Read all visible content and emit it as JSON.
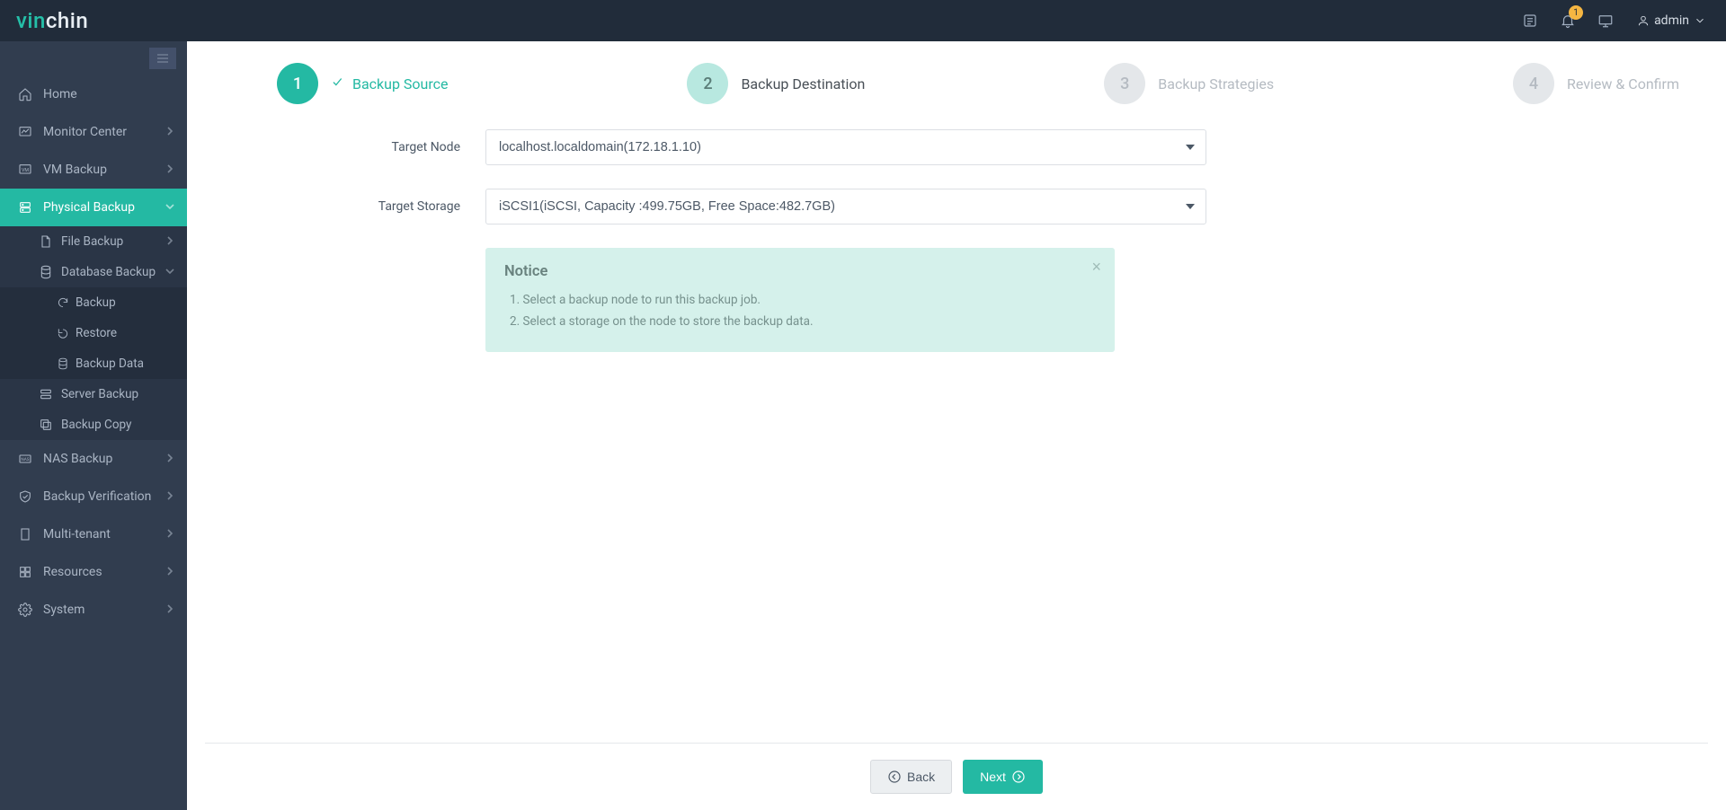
{
  "brand": {
    "part1": "vin",
    "part2": "chin"
  },
  "topbar": {
    "bell_badge": "1",
    "username": "admin"
  },
  "sidebar": {
    "home": "Home",
    "monitor": "Monitor Center",
    "vm": "VM Backup",
    "physical": "Physical Backup",
    "file": "File Backup",
    "database": "Database Backup",
    "db_backup": "Backup",
    "db_restore": "Restore",
    "db_data": "Backup Data",
    "server": "Server Backup",
    "copy": "Backup Copy",
    "nas": "NAS Backup",
    "verify": "Backup Verification",
    "tenant": "Multi-tenant",
    "resources": "Resources",
    "system": "System"
  },
  "wizard": {
    "step1_num": "1",
    "step1_label": "Backup Source",
    "step2_num": "2",
    "step2_label": "Backup Destination",
    "step3_num": "3",
    "step3_label": "Backup Strategies",
    "step4_num": "4",
    "step4_label": "Review & Confirm"
  },
  "form": {
    "target_node_label": "Target Node",
    "target_node_value": "localhost.localdomain(172.18.1.10)",
    "target_storage_label": "Target Storage",
    "target_storage_value": "iSCSI1(iSCSI, Capacity :499.75GB, Free Space:482.7GB)"
  },
  "notice": {
    "title": "Notice",
    "line1": "1. Select a backup node to run this backup job.",
    "line2": "2. Select a storage on the node to store the backup data."
  },
  "buttons": {
    "back": "Back",
    "next": "Next"
  }
}
